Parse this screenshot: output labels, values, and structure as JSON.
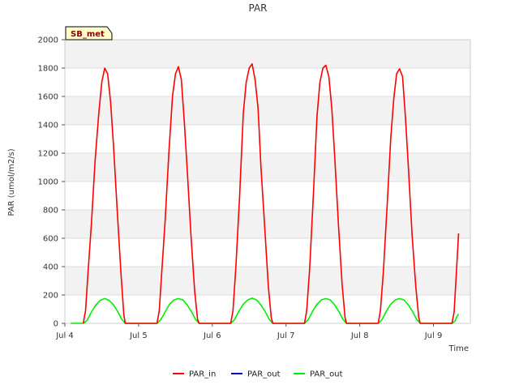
{
  "chart_data": {
    "type": "line",
    "title": "PAR",
    "xlabel": "Time",
    "ylabel": "PAR (umol/m2/s)",
    "site_label": "SB_met",
    "xlim": [
      4.0,
      9.5
    ],
    "ylim": [
      0,
      2000
    ],
    "x_ticks": [
      {
        "value": 4,
        "label": "Jul 4"
      },
      {
        "value": 5,
        "label": "Jul 5"
      },
      {
        "value": 6,
        "label": "Jul 6"
      },
      {
        "value": 7,
        "label": "Jul 7"
      },
      {
        "value": 8,
        "label": "Jul 8"
      },
      {
        "value": 9,
        "label": "Jul 9"
      }
    ],
    "y_ticks": [
      0,
      200,
      400,
      600,
      800,
      1000,
      1200,
      1400,
      1600,
      1800,
      2000
    ],
    "grid": true,
    "legend_position": "bottom",
    "series": [
      {
        "name": "PAR_in",
        "color": "#ff0000",
        "points": [
          [
            4.25,
            0
          ],
          [
            4.28,
            90
          ],
          [
            4.31,
            330
          ],
          [
            4.36,
            700
          ],
          [
            4.41,
            1150
          ],
          [
            4.46,
            1480
          ],
          [
            4.5,
            1700
          ],
          [
            4.54,
            1800
          ],
          [
            4.58,
            1760
          ],
          [
            4.62,
            1560
          ],
          [
            4.66,
            1250
          ],
          [
            4.71,
            800
          ],
          [
            4.76,
            360
          ],
          [
            4.8,
            60
          ],
          [
            4.82,
            0
          ],
          [
            5.25,
            0
          ],
          [
            5.28,
            90
          ],
          [
            5.31,
            330
          ],
          [
            5.36,
            720
          ],
          [
            5.41,
            1200
          ],
          [
            5.46,
            1600
          ],
          [
            5.5,
            1760
          ],
          [
            5.54,
            1810
          ],
          [
            5.58,
            1720
          ],
          [
            5.62,
            1420
          ],
          [
            5.66,
            1080
          ],
          [
            5.71,
            620
          ],
          [
            5.76,
            230
          ],
          [
            5.8,
            30
          ],
          [
            5.82,
            0
          ],
          [
            6.25,
            0
          ],
          [
            6.28,
            90
          ],
          [
            6.32,
            400
          ],
          [
            6.37,
            900
          ],
          [
            6.42,
            1480
          ],
          [
            6.46,
            1700
          ],
          [
            6.5,
            1800
          ],
          [
            6.54,
            1830
          ],
          [
            6.58,
            1720
          ],
          [
            6.62,
            1520
          ],
          [
            6.66,
            1100
          ],
          [
            6.71,
            680
          ],
          [
            6.76,
            260
          ],
          [
            6.8,
            40
          ],
          [
            6.82,
            0
          ],
          [
            7.25,
            0
          ],
          [
            7.28,
            90
          ],
          [
            7.32,
            380
          ],
          [
            7.37,
            900
          ],
          [
            7.42,
            1460
          ],
          [
            7.46,
            1700
          ],
          [
            7.5,
            1800
          ],
          [
            7.54,
            1820
          ],
          [
            7.58,
            1740
          ],
          [
            7.62,
            1520
          ],
          [
            7.66,
            1180
          ],
          [
            7.71,
            700
          ],
          [
            7.76,
            280
          ],
          [
            7.8,
            40
          ],
          [
            7.82,
            0
          ],
          [
            8.25,
            0
          ],
          [
            8.28,
            90
          ],
          [
            8.32,
            360
          ],
          [
            8.37,
            820
          ],
          [
            8.42,
            1300
          ],
          [
            8.46,
            1580
          ],
          [
            8.5,
            1760
          ],
          [
            8.54,
            1795
          ],
          [
            8.58,
            1740
          ],
          [
            8.62,
            1450
          ],
          [
            8.66,
            1100
          ],
          [
            8.71,
            620
          ],
          [
            8.76,
            260
          ],
          [
            8.8,
            40
          ],
          [
            8.82,
            0
          ],
          [
            9.25,
            0
          ],
          [
            9.28,
            80
          ],
          [
            9.31,
            350
          ],
          [
            9.34,
            635
          ]
        ]
      },
      {
        "name": "PAR_out",
        "color": "#0000cc",
        "points": []
      },
      {
        "name": "PAR_out",
        "color": "#00ee00",
        "points": [
          [
            4.08,
            0
          ],
          [
            4.25,
            0
          ],
          [
            4.3,
            20
          ],
          [
            4.36,
            80
          ],
          [
            4.42,
            130
          ],
          [
            4.48,
            162
          ],
          [
            4.54,
            175
          ],
          [
            4.6,
            162
          ],
          [
            4.66,
            130
          ],
          [
            4.72,
            80
          ],
          [
            4.77,
            30
          ],
          [
            4.82,
            0
          ],
          [
            5.25,
            0
          ],
          [
            5.3,
            25
          ],
          [
            5.36,
            80
          ],
          [
            5.42,
            135
          ],
          [
            5.48,
            165
          ],
          [
            5.54,
            175
          ],
          [
            5.6,
            165
          ],
          [
            5.66,
            130
          ],
          [
            5.72,
            80
          ],
          [
            5.77,
            30
          ],
          [
            5.82,
            0
          ],
          [
            6.25,
            0
          ],
          [
            6.3,
            25
          ],
          [
            6.36,
            85
          ],
          [
            6.42,
            135
          ],
          [
            6.48,
            165
          ],
          [
            6.54,
            178
          ],
          [
            6.6,
            165
          ],
          [
            6.66,
            130
          ],
          [
            6.72,
            80
          ],
          [
            6.77,
            30
          ],
          [
            6.82,
            0
          ],
          [
            7.25,
            0
          ],
          [
            7.3,
            25
          ],
          [
            7.36,
            85
          ],
          [
            7.42,
            135
          ],
          [
            7.48,
            165
          ],
          [
            7.54,
            175
          ],
          [
            7.6,
            165
          ],
          [
            7.66,
            130
          ],
          [
            7.72,
            80
          ],
          [
            7.77,
            30
          ],
          [
            7.82,
            0
          ],
          [
            8.25,
            0
          ],
          [
            8.3,
            25
          ],
          [
            8.36,
            85
          ],
          [
            8.42,
            135
          ],
          [
            8.48,
            165
          ],
          [
            8.54,
            175
          ],
          [
            8.6,
            165
          ],
          [
            8.66,
            130
          ],
          [
            8.72,
            80
          ],
          [
            8.77,
            30
          ],
          [
            8.82,
            0
          ],
          [
            9.25,
            0
          ],
          [
            9.29,
            15
          ],
          [
            9.32,
            50
          ],
          [
            9.34,
            65
          ]
        ]
      }
    ],
    "legend": [
      {
        "label": "PAR_in",
        "color": "#ff0000"
      },
      {
        "label": "PAR_out",
        "color": "#0000cc"
      },
      {
        "label": "PAR_out",
        "color": "#00ee00"
      }
    ]
  }
}
